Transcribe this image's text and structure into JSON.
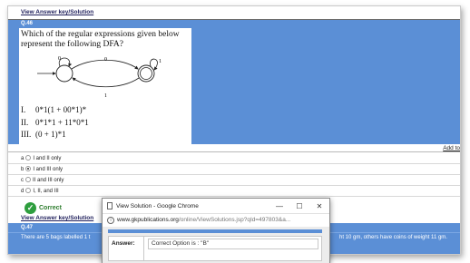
{
  "top_link": "View Answer key/Solution",
  "question": {
    "number": "Q.46",
    "text": "Which of the regular expressions given below represent the following DFA?",
    "dfa_labels": [
      "0",
      "0",
      "1",
      "1"
    ],
    "expressions": [
      {
        "num": "I.",
        "expr": "0*1(1 + 00*1)*"
      },
      {
        "num": "II.",
        "expr": "0*1*1 + 11*0*1"
      },
      {
        "num": "III.",
        "expr": "(0 + 1)*1"
      }
    ]
  },
  "add_link": "Add to",
  "options": [
    {
      "key": "a",
      "label": "I and II only",
      "selected": false
    },
    {
      "key": "b",
      "label": "I and III only",
      "selected": true
    },
    {
      "key": "c",
      "label": "II and III only",
      "selected": false
    },
    {
      "key": "d",
      "label": "I, II, and III",
      "selected": false
    }
  ],
  "result": {
    "label": "Correct",
    "icon": "check-icon"
  },
  "bottom_link": "View Answer key/Solution",
  "next_question": {
    "number": "Q.47",
    "text": "There are 5 bags labelled 1 t",
    "text_right": "ht 10 gm, others have coins of weight 11 gm."
  },
  "popup": {
    "title": "View Solution - Google Chrome",
    "url_host": "www.gkpublications.org",
    "url_rest": "/online/ViewSolutions.jsp?qId=497803&a...",
    "answer_label": "Answer:",
    "answer_value": "Correct Option is : \"B\""
  },
  "colors": {
    "accent": "#5b8fd6",
    "correct": "#2e9e3e"
  }
}
